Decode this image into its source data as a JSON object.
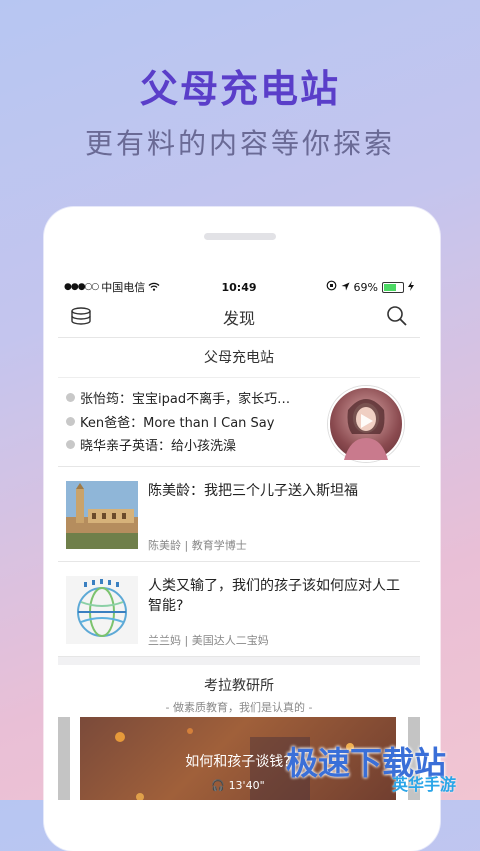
{
  "promo": {
    "title": "父母充电站",
    "subtitle": "更有料的内容等你探索"
  },
  "statusbar": {
    "signal": "●●●○○",
    "carrier": "中国电信",
    "time": "10:49",
    "battery": "69%",
    "battery_level": 0.69
  },
  "navbar": {
    "title": "发现",
    "left_icon": "coin-stack-icon",
    "right_icon": "search-icon"
  },
  "section1": {
    "title": "父母充电站",
    "bullets": [
      "张怡筠：宝宝ipad不离手，家长巧…",
      "Ken爸爸：More than I Can Say",
      "晓华亲子英语：给小孩洗澡"
    ]
  },
  "articles": [
    {
      "headline": "陈美龄：我把三个儿子送入斯坦福",
      "meta": "陈美龄 | 教育学博士"
    },
    {
      "headline": "人类又输了，我们的孩子该如何应对人工智能?",
      "meta": "兰兰妈 | 美国达人二宝妈"
    }
  ],
  "section2": {
    "title": "考拉教研所",
    "subtitle": "- 做素质教育，我们是认真的 -",
    "video_title": "如何和孩子谈钱?",
    "video_duration": "13'40\""
  },
  "watermark": {
    "line1": "极速下载站",
    "line2": "英华手游"
  },
  "colors": {
    "title_purple": "#5a3ec9",
    "battery_green": "#4cd964"
  }
}
